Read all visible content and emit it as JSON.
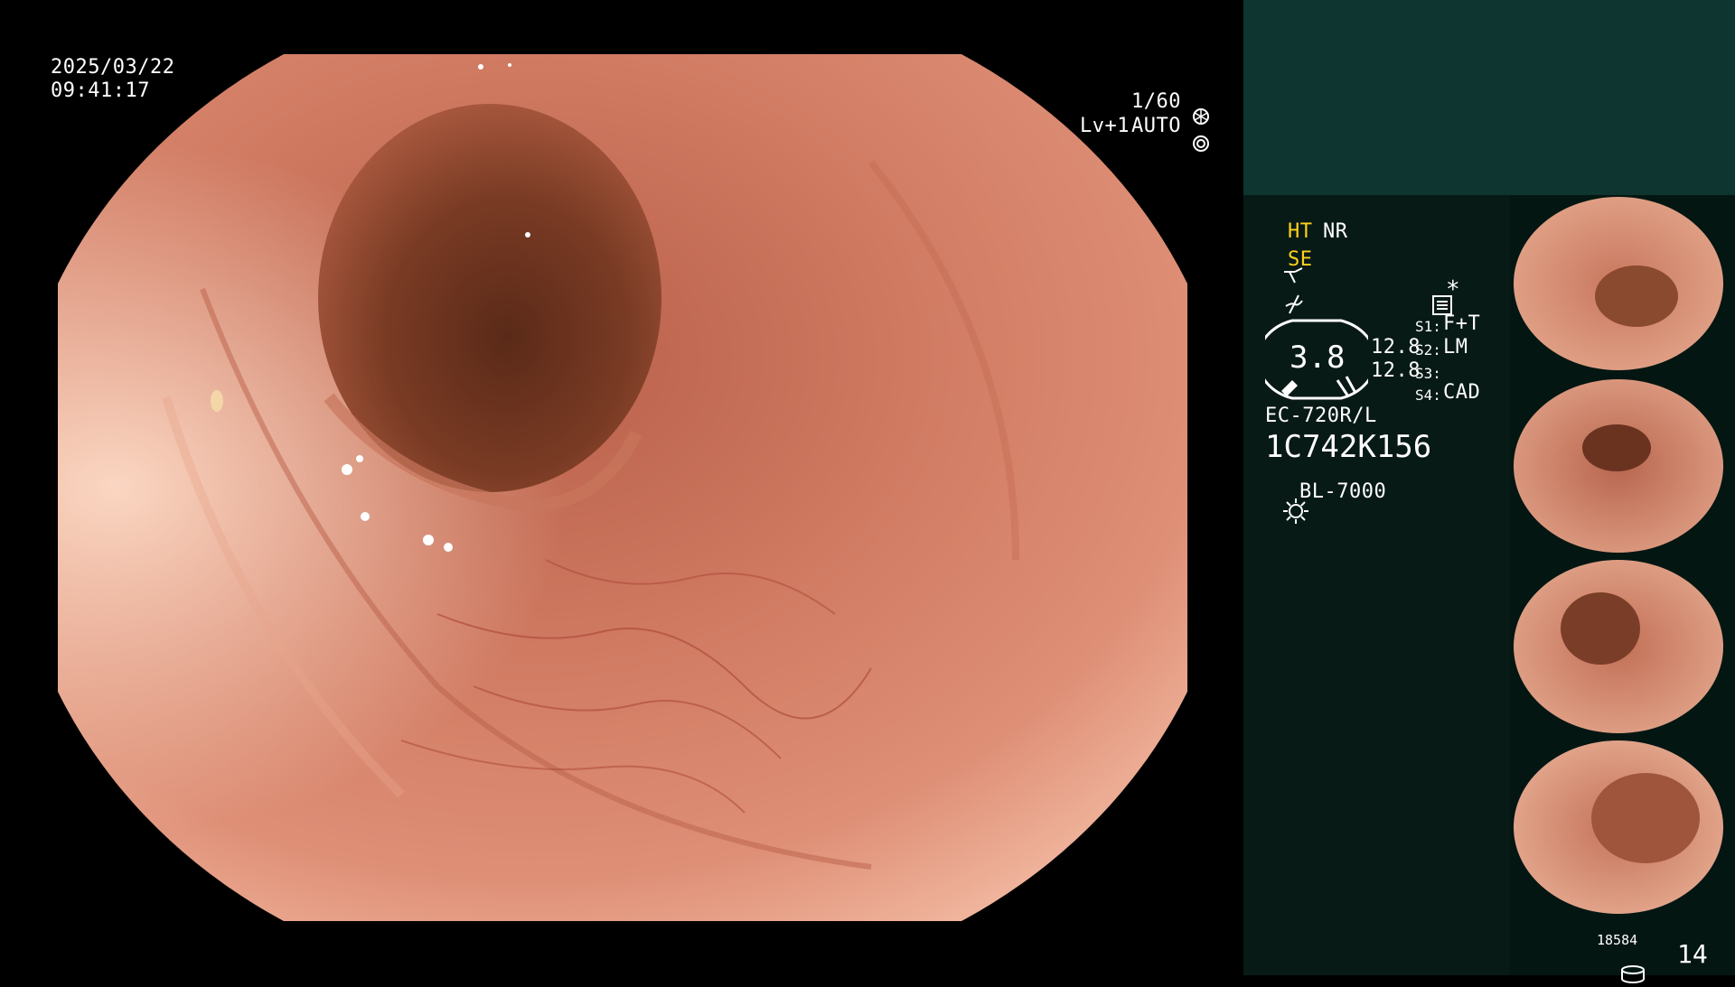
{
  "osd": {
    "date": "2025/03/22",
    "time": "09:41:17",
    "shutter": "1/60",
    "level": "Lv+1",
    "mode": "AUTO"
  },
  "settings": {
    "ht": "HT",
    "nr": "NR",
    "se": "SE",
    "gauge_value": "3.8",
    "val_a": "12.8",
    "val_b": "12.8",
    "s1_label": "S1:",
    "s1_value": "F+T",
    "s2_label": "S2:",
    "s2_value": "LM",
    "s3_label": "S3:",
    "s3_value": "",
    "s4_label": "S4:",
    "s4_value": "CAD",
    "scope_model": "EC-720R/L",
    "scope_serial": "1C742K156",
    "light_source": "BL-7000"
  },
  "footer": {
    "storage_count": "18584",
    "image_count": "14"
  },
  "colors": {
    "panel_top": "#0f3530",
    "panel": "#081a16",
    "highlight": "#ffd21a",
    "mucosa": "#d9826a"
  },
  "icons": [
    "shutter-icon",
    "auto-iris-icon",
    "scope-icon",
    "flash-icon",
    "menu-icon",
    "asterisk-icon",
    "light-source-icon",
    "storage-icon"
  ]
}
